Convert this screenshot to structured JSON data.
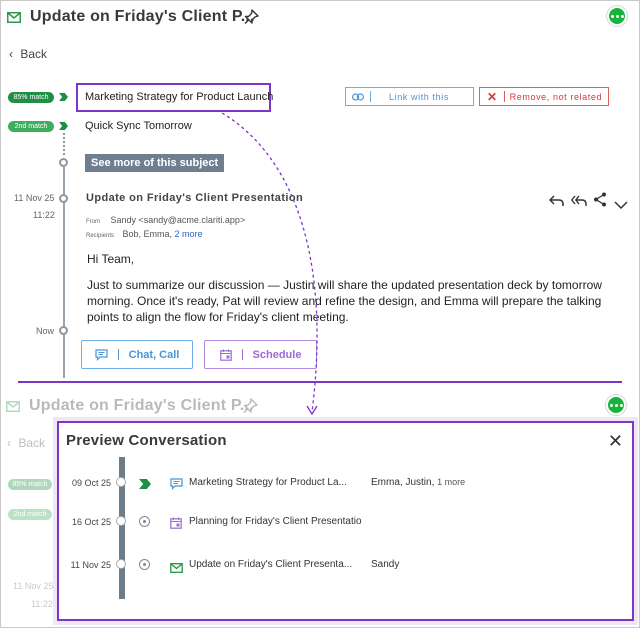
{
  "header": {
    "title": "Update on Friday's Client P..."
  },
  "nav": {
    "back_label": "Back"
  },
  "matches": [
    {
      "badge": "85% match",
      "subject": "Marketing Strategy for Product Launch"
    },
    {
      "badge": "2nd match",
      "subject": "Quick Sync Tomorrow"
    }
  ],
  "actions": {
    "link_label": "Link with this",
    "remove_label": "Remove, not related"
  },
  "see_more_label": "See more of this subject",
  "email": {
    "date": "11 Nov 25",
    "time": "11:22",
    "subject": "Update on Friday's Client Presentation",
    "from_label": "From",
    "from_value": "Sandy <sandy@acme.clariti.app>",
    "recipients_label": "Recipients",
    "recipients_value": "Bob, Emma, ",
    "recipients_more": "2 more",
    "greeting": "Hi Team,",
    "body": "Just to summarize our discussion — Justin will share the updated presentation deck by tomorrow morning. Once it's ready, Pat will review and refine the design, and Emma will prepare the talking points to align the flow for Friday's client meeting."
  },
  "now_label": "Now",
  "bottom_buttons": {
    "chat_call": "Chat, Call",
    "schedule": "Schedule"
  },
  "background": {
    "title": "Update on Friday's Client P...",
    "back_label": "Back",
    "badge1": "85% match",
    "badge2": "2nd match",
    "date": "11 Nov 25",
    "time": "11:22"
  },
  "preview": {
    "title": "Preview Conversation",
    "rows": [
      {
        "date": "09 Oct 25",
        "subject": "Marketing Strategy for Product La...",
        "people": "Emma, Justin,",
        "more": "1 more"
      },
      {
        "date": "16 Oct 25",
        "subject": "Planning for Friday's Client Presentatio",
        "people": "",
        "more": ""
      },
      {
        "date": "11 Nov 25",
        "subject": "Update on Friday's Client Presenta...",
        "people": "Sandy",
        "more": ""
      }
    ]
  },
  "colors": {
    "accent_purple": "#7b36c8",
    "match_green": "#1f8f46",
    "link_blue": "#4a94d6",
    "remove_red": "#d23b3b"
  }
}
